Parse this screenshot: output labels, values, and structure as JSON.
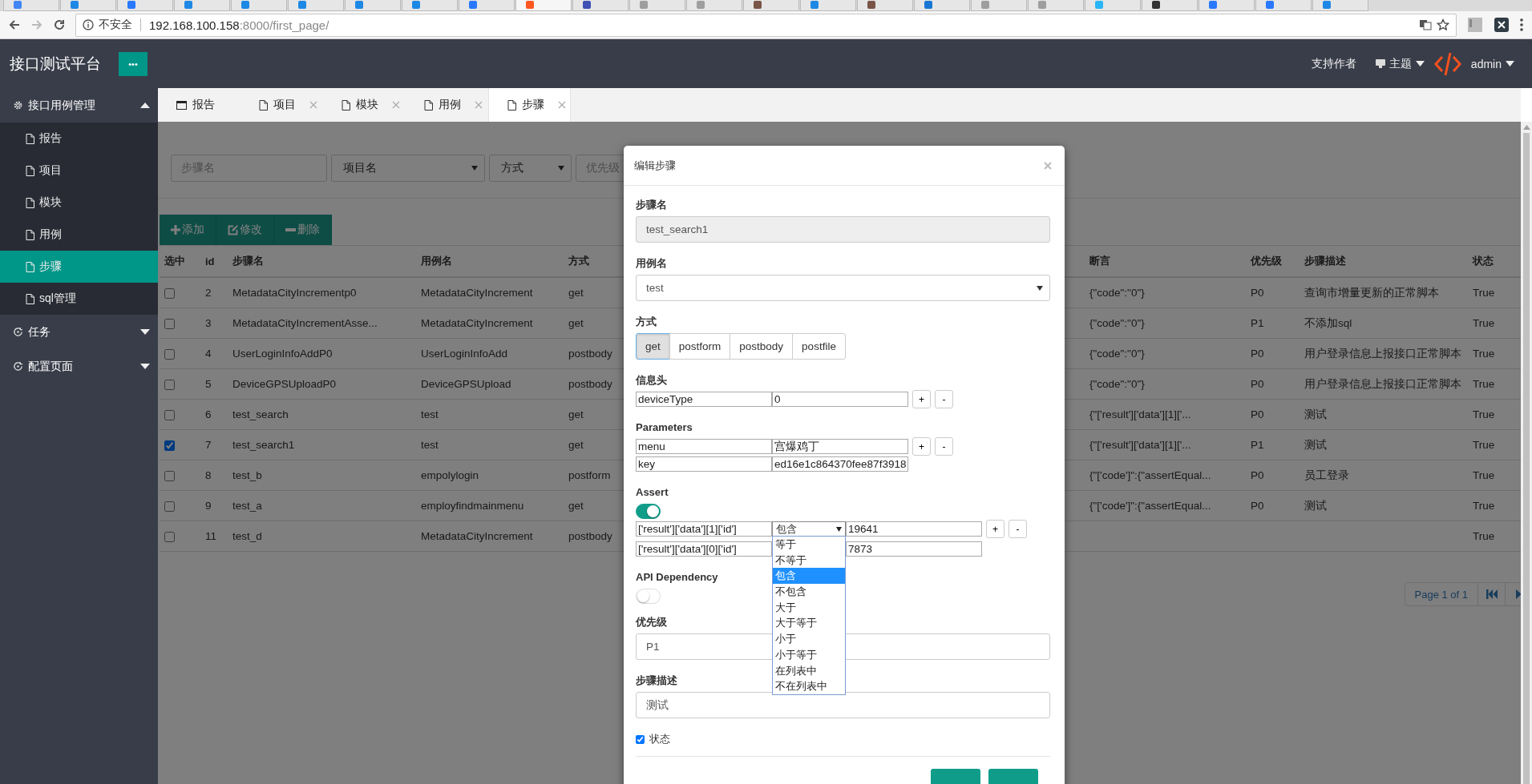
{
  "browser": {
    "tabs": [
      {
        "selected": false
      },
      {
        "selected": false
      },
      {
        "selected": false
      },
      {
        "selected": false
      },
      {
        "selected": false
      },
      {
        "selected": false
      },
      {
        "selected": false
      },
      {
        "selected": false
      },
      {
        "selected": false
      },
      {
        "selected": true
      },
      {
        "selected": false
      },
      {
        "selected": false
      },
      {
        "selected": false
      },
      {
        "selected": false
      },
      {
        "selected": false
      },
      {
        "selected": false
      },
      {
        "selected": false
      },
      {
        "selected": false
      },
      {
        "selected": false
      },
      {
        "selected": false
      },
      {
        "selected": false
      },
      {
        "selected": false
      },
      {
        "selected": false
      },
      {
        "selected": false
      }
    ],
    "back_disabled": false,
    "forward_disabled": true,
    "security_label": "不安全",
    "url_host": "192.168.100.158",
    "url_path": ":8000/first_page/"
  },
  "header": {
    "title": "接口测试平台",
    "more_button": "•••",
    "support_link": "支持作者",
    "theme_menu": "主题",
    "user_menu": "admin"
  },
  "sidebar": {
    "groups": [
      {
        "label": "接口用例管理",
        "kind": "gear",
        "expanded": true,
        "children": [
          {
            "label": "报告",
            "selected": false
          },
          {
            "label": "项目",
            "selected": false
          },
          {
            "label": "模块",
            "selected": false
          },
          {
            "label": "用例",
            "selected": false
          },
          {
            "label": "步骤",
            "selected": true
          },
          {
            "label": "sql管理",
            "selected": false
          }
        ]
      },
      {
        "label": "任务",
        "kind": "cycle",
        "expanded": false
      },
      {
        "label": "配置页面",
        "kind": "cycle",
        "expanded": false
      }
    ]
  },
  "tabs": [
    {
      "label": "报告",
      "kind": "window",
      "closable": false,
      "selected": false
    },
    {
      "label": "项目",
      "kind": "page",
      "closable": true,
      "selected": false
    },
    {
      "label": "模块",
      "kind": "page",
      "closable": true,
      "selected": false
    },
    {
      "label": "用例",
      "kind": "page",
      "closable": true,
      "selected": false
    },
    {
      "label": "步骤",
      "kind": "page",
      "closable": true,
      "selected": true
    }
  ],
  "filters": {
    "step_name_placeholder": "步骤名",
    "project_select": "项目名",
    "method_select": "方式",
    "priority_select": "优先级"
  },
  "toolbar": [
    {
      "label": "添加",
      "kind": "plus"
    },
    {
      "label": "修改",
      "kind": "edit"
    },
    {
      "label": "删除",
      "kind": "minus"
    }
  ],
  "table": {
    "columns": [
      "选中",
      "id",
      "步骤名",
      "用例名",
      "方式",
      "断言",
      "优先级",
      "步骤描述",
      "状态"
    ],
    "rows": [
      {
        "checked": false,
        "id": "2",
        "step": "MetadataCityIncrementp0",
        "case": "MetadataCityIncrement",
        "method": "get",
        "assert": "{\"code\":\"0\"}",
        "priority": "P0",
        "desc": "查询市增量更新的正常脚本",
        "status": "True"
      },
      {
        "checked": false,
        "id": "3",
        "step": "MetadataCityIncrementAsse...",
        "case": "MetadataCityIncrement",
        "method": "get",
        "assert": "{\"code\":\"0\"}",
        "priority": "P1",
        "desc": "不添加sql",
        "status": "True"
      },
      {
        "checked": false,
        "id": "4",
        "step": "UserLoginInfoAddP0",
        "case": "UserLoginInfoAdd",
        "method": "postbody",
        "assert": "{\"code\":\"0\"}",
        "priority": "P0",
        "desc": "用户登录信息上报接口正常脚本",
        "status": "True"
      },
      {
        "checked": false,
        "id": "5",
        "step": "DeviceGPSUploadP0",
        "case": "DeviceGPSUpload",
        "method": "postbody",
        "assert": "{\"code\":\"0\"}",
        "priority": "P0",
        "desc": "用户登录信息上报接口正常脚本",
        "status": "True"
      },
      {
        "checked": false,
        "id": "6",
        "step": "test_search",
        "case": "test",
        "method": "get",
        "assert": "{\"['result']['data'][1]['...",
        "priority": "P0",
        "desc": "测试",
        "status": "True"
      },
      {
        "checked": true,
        "id": "7",
        "step": "test_search1",
        "case": "test",
        "method": "get",
        "assert": "{\"['result']['data'][1]['...",
        "priority": "P1",
        "desc": "测试",
        "status": "True"
      },
      {
        "checked": false,
        "id": "8",
        "step": "test_b",
        "case": "empolylogin",
        "method": "postform",
        "assert": "{\"['code']\":{\"assertEqual...",
        "priority": "P0",
        "desc": "员工登录",
        "status": "True"
      },
      {
        "checked": false,
        "id": "9",
        "step": "test_a",
        "case": "employfindmainmenu",
        "method": "get",
        "assert": "{\"['code']\":{\"assertEqual...",
        "priority": "P0",
        "desc": "测试",
        "status": "True"
      },
      {
        "checked": false,
        "id": "11",
        "step": "test_d",
        "case": "MetadataCityIncrement",
        "method": "postbody",
        "status": "True"
      }
    ]
  },
  "pagination": {
    "label": "Page 1 of 1"
  },
  "modal": {
    "title": "编辑步骤",
    "step_name": {
      "label": "步骤名",
      "value": "test_search1"
    },
    "case_name": {
      "label": "用例名",
      "value": "test"
    },
    "method": {
      "label": "方式",
      "options": [
        {
          "label": "get",
          "selected": true
        },
        {
          "label": "postform",
          "selected": false
        },
        {
          "label": "postbody",
          "selected": false
        },
        {
          "label": "postfile",
          "selected": false
        }
      ]
    },
    "headers": {
      "label": "信息头",
      "rows": [
        {
          "key": "deviceType",
          "value": "0"
        }
      ],
      "add": "+",
      "remove": "-"
    },
    "parameters": {
      "label": "Parameters",
      "rows": [
        {
          "key": "menu",
          "value": "宫爆鸡丁"
        },
        {
          "key": "key",
          "value": "ed16e1c864370fee87f3918"
        }
      ],
      "add": "+",
      "remove": "-"
    },
    "assert": {
      "label": "Assert",
      "on": true,
      "rows": [
        {
          "path": "['result']['data'][1]['id']",
          "operator": "包含",
          "value": "19641"
        },
        {
          "path": "['result']['data'][0]['id']",
          "value": "7873"
        }
      ],
      "add": "+",
      "remove": "-",
      "operator_options": [
        {
          "label": "等于",
          "selected": false
        },
        {
          "label": "不等于",
          "selected": false
        },
        {
          "label": "包含",
          "selected": true
        },
        {
          "label": "不包含",
          "selected": false
        },
        {
          "label": "大于",
          "selected": false
        },
        {
          "label": "大于等于",
          "selected": false
        },
        {
          "label": "小于",
          "selected": false
        },
        {
          "label": "小于等于",
          "selected": false
        },
        {
          "label": "在列表中",
          "selected": false
        },
        {
          "label": "不在列表中",
          "selected": false
        }
      ]
    },
    "api_dependency": {
      "label": "API Dependency",
      "on": false
    },
    "priority": {
      "label": "优先级",
      "value": "P1"
    },
    "description": {
      "label": "步骤描述",
      "value": "测试"
    },
    "status": {
      "label": "状态",
      "checked": true
    }
  }
}
